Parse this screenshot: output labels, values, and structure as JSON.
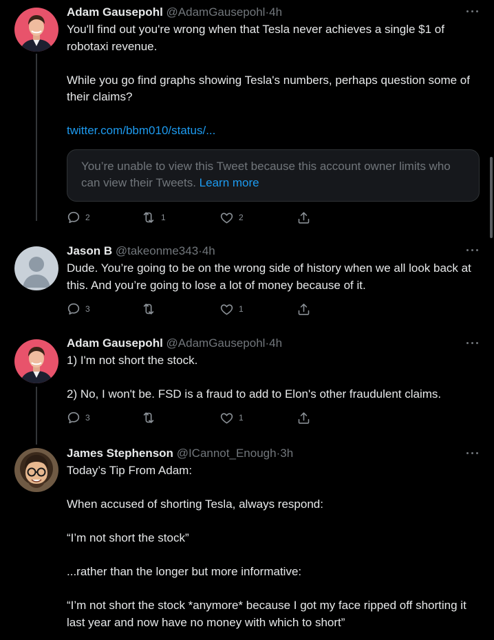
{
  "tweets": [
    {
      "name": "Adam Gausepohl",
      "handle": "@AdamGausepohl",
      "dot": "·",
      "time": "4h",
      "avatar": "portrait-man-pink-bg",
      "paragraphs": [
        "You'll find out you're wrong when that Tesla never achieves a single $1 of robotaxi revenue.",
        "While you go find graphs showing Tesla's numbers, perhaps question some of their claims?"
      ],
      "link": "twitter.com/bbm010/status/...",
      "quote": {
        "text": "You’re unable to view this Tweet because this account owner limits who can view their Tweets.",
        "link_label": "Learn more"
      },
      "actions": {
        "reply": "2",
        "retweet": "1",
        "like": "2"
      }
    },
    {
      "name": "Jason B",
      "handle": "@takeonme343",
      "dot": "·",
      "time": "4h",
      "avatar": "default-profile-placeholder",
      "paragraphs": [
        "Dude. You’re going to be on the wrong side of history when we all look back at this. And you’re going to lose a lot of money because of it."
      ],
      "actions": {
        "reply": "3",
        "retweet": "",
        "like": "1"
      }
    },
    {
      "name": "Adam Gausepohl",
      "handle": "@AdamGausepohl",
      "dot": "·",
      "time": "4h",
      "avatar": "portrait-man-pink-bg",
      "paragraphs": [
        "1) I'm not short the stock.",
        "2) No, I won't be. FSD is a fraud to add to Elon's other fraudulent claims."
      ],
      "actions": {
        "reply": "3",
        "retweet": "",
        "like": "1"
      }
    },
    {
      "name": "James Stephenson",
      "handle": "@ICannot_Enough",
      "dot": "·",
      "time": "3h",
      "avatar": "portrait-man-glasses",
      "paragraphs": [
        "Today’s Tip From Adam:",
        "When accused of shorting Tesla, always respond:",
        "“I’m not short the stock”",
        "...rather than the longer but more informative:",
        "“I’m not short the stock *anymore* because I got my face ripped off shorting it last year and now have no money with which to short”"
      ]
    }
  ],
  "colors": {
    "background": "#000000",
    "text": "#e7e9ea",
    "secondary": "#71767b",
    "link": "#1d9bf0",
    "quote_bg": "#16181c",
    "border": "#2f3336",
    "thread_line": "#333639"
  },
  "icons": {
    "more": "more-horizontal-icon",
    "reply": "reply-bubble-icon",
    "retweet": "retweet-icon",
    "like": "heart-icon",
    "share": "share-upload-icon"
  }
}
